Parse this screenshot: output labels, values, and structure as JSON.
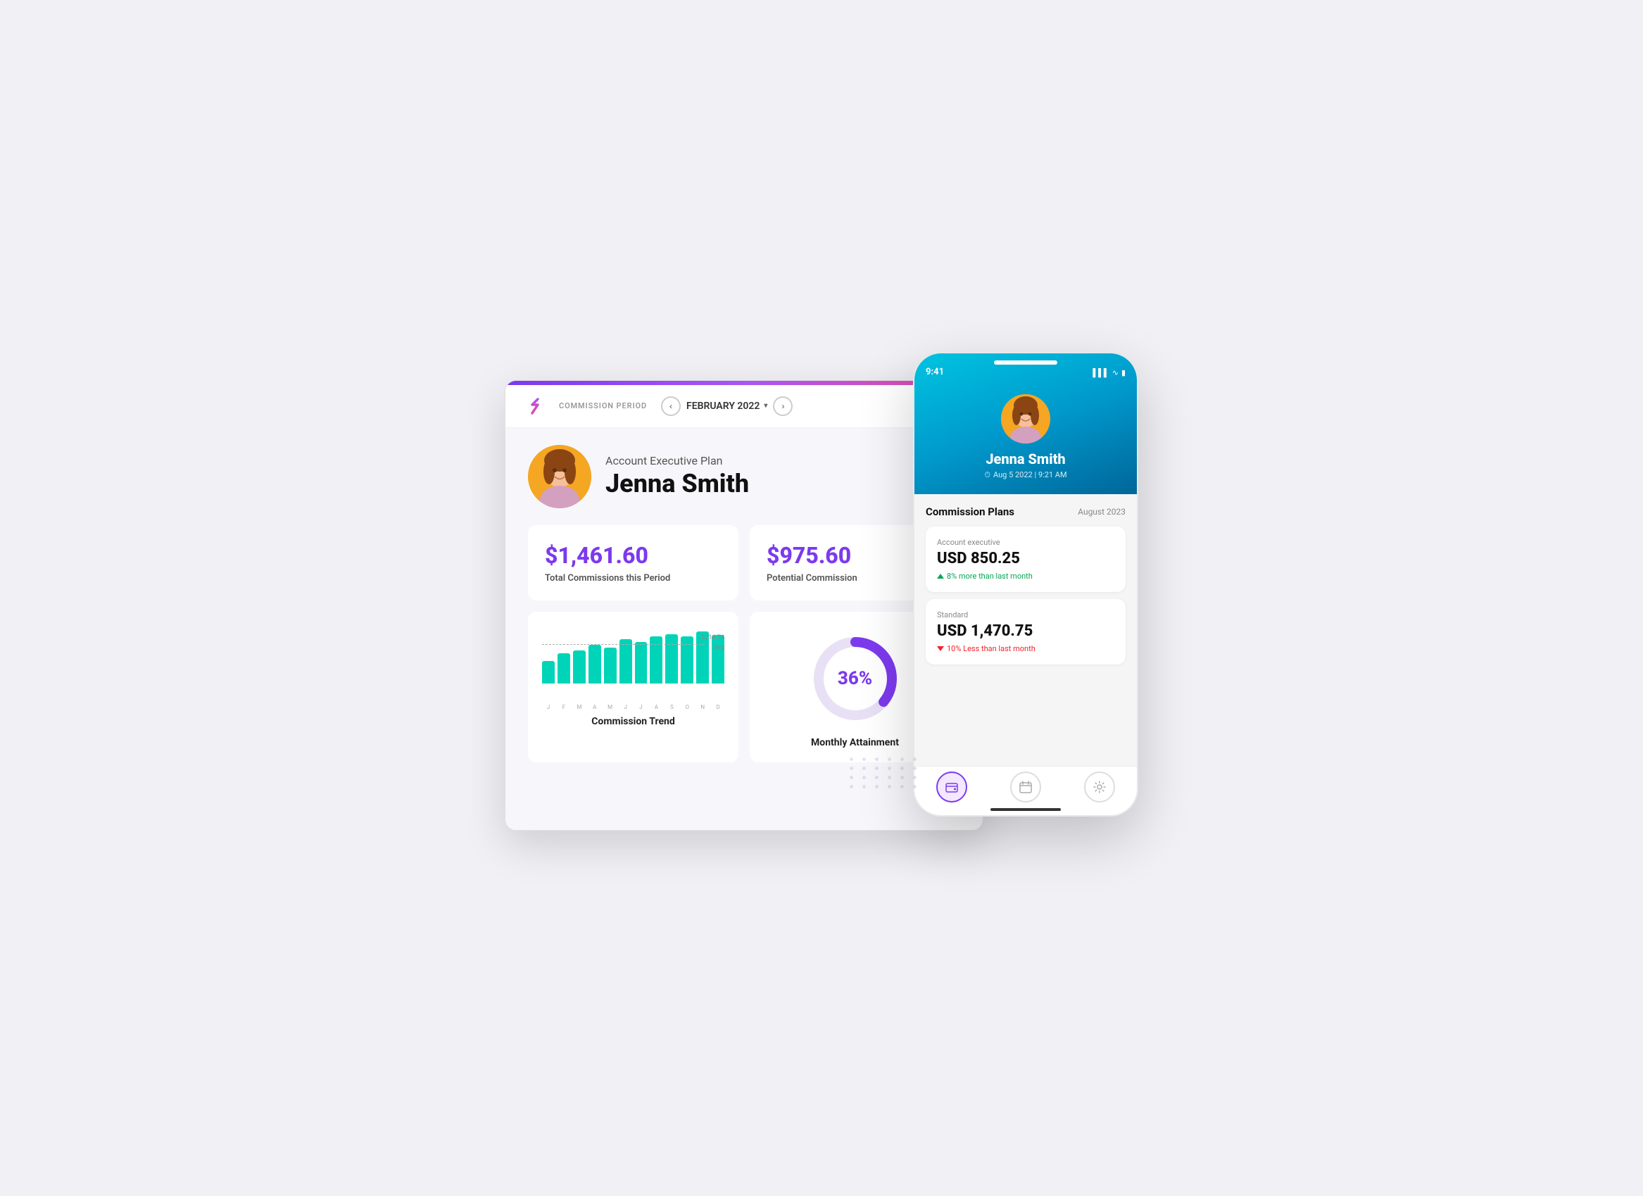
{
  "app": {
    "logo_text": "S",
    "commission_period_label": "COMMISSION PERIOD",
    "period_value": "FEBRUARY 2022",
    "prev_btn_label": "<",
    "next_btn_label": ">"
  },
  "profile": {
    "plan_label": "Account Executive Plan",
    "user_name": "Jenna Smith"
  },
  "stats": {
    "total_commissions_value": "$1,461.60",
    "total_commissions_label": "Total Commissions this Period",
    "potential_commission_value": "$975.60",
    "potential_commission_label": "Potential Commission"
  },
  "chart": {
    "title": "Commission Trend",
    "avg_value": "$216.74",
    "avg_label": "Avg",
    "months": [
      "J",
      "F",
      "M",
      "A",
      "M",
      "J",
      "J",
      "A",
      "S",
      "O",
      "N",
      "D"
    ],
    "bars": [
      40,
      55,
      60,
      70,
      65,
      80,
      75,
      85,
      90,
      85,
      95,
      88
    ]
  },
  "donut": {
    "title": "Monthly Attainment",
    "percentage": "36%",
    "value": 36,
    "color_filled": "#7c3aed",
    "color_empty": "#e8e0f5"
  },
  "mobile": {
    "status_time": "9:41",
    "status_signal": "▌▌▌",
    "status_wifi": "WiFi",
    "status_battery": "Battery",
    "user_name": "Jenna Smith",
    "timestamp": "Aug 5 2022 | 9:21 AM",
    "section_title": "Commission Plans",
    "section_date": "August 2023",
    "cards": [
      {
        "type": "Account executive",
        "amount": "USD 850.25",
        "change_text": "8% more than last month",
        "change_direction": "up"
      },
      {
        "type": "Standard",
        "amount": "USD 1,470.75",
        "change_text": "10% Less than last month",
        "change_direction": "down"
      }
    ],
    "nav_icons": [
      "wallet",
      "calendar",
      "settings"
    ]
  }
}
